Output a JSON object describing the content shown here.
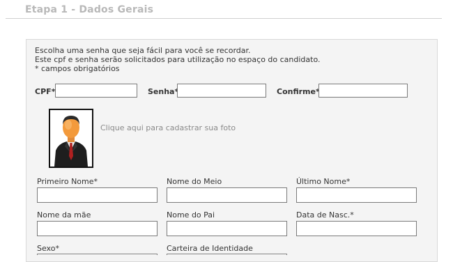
{
  "page": {
    "heading": "Etapa 1 - Dados Gerais"
  },
  "intro": {
    "line1": "Escolha uma senha que seja fácil para você se recordar.",
    "line2": "Este cpf e senha serão solicitados para utilização no espaço do candidato.",
    "line3": "* campos obrigatórios"
  },
  "credentials": {
    "cpf_label": "CPF*",
    "cpf_value": "",
    "senha_label": "Senha*",
    "senha_value": "",
    "confirme_label": "Confirme*",
    "confirme_value": ""
  },
  "photo": {
    "icon": "person-avatar-icon",
    "link_text": "Clique aqui para cadastrar sua foto"
  },
  "fields": {
    "primeiro_nome_label": "Primeiro Nome*",
    "nome_do_meio_label": "Nome do Meio",
    "ultimo_nome_label": "Último Nome*",
    "nome_da_mae_label": "Nome da mãe",
    "nome_do_pai_label": "Nome do Pai",
    "data_nasc_label": "Data de Nasc.*",
    "sexo_label": "Sexo*",
    "carteira_label": "Carteira de Identidade"
  }
}
